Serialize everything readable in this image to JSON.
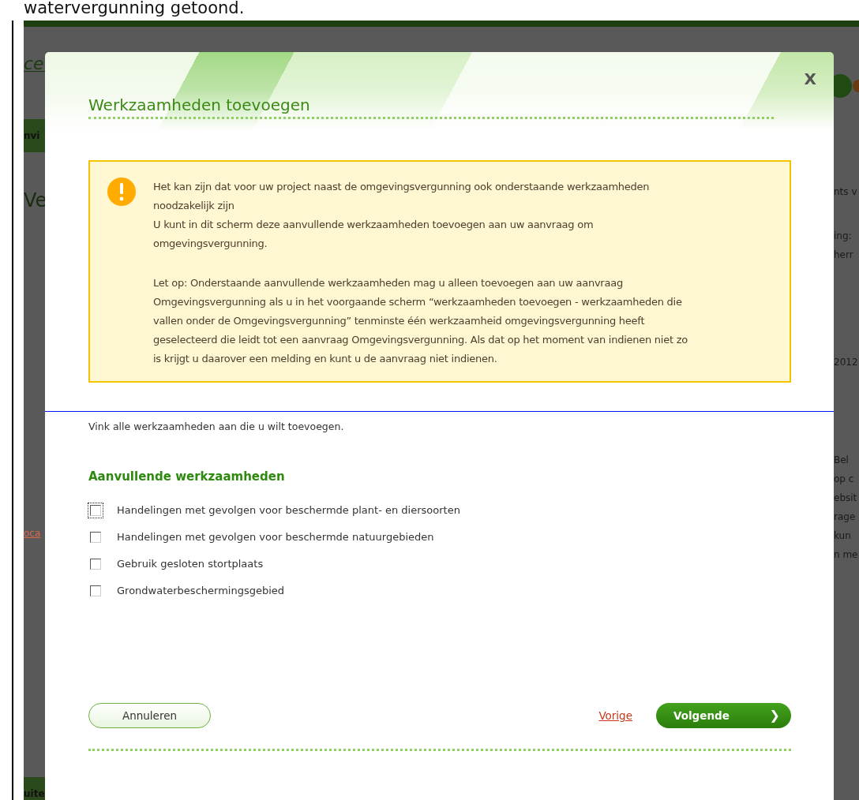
{
  "page_heading": "watervergunning getoond.",
  "background_left": [
    {
      "text": "ce",
      "kind": "logo"
    },
    {
      "text": "nvi",
      "kind": "band"
    },
    {
      "text": "Ve",
      "kind": "heading"
    },
    {
      "text": "oca",
      "kind": "link"
    },
    {
      "text": "uite",
      "kind": "band"
    }
  ],
  "background_right": [
    {
      "text": "nts v",
      "kind": "text"
    },
    {
      "text": "ing:",
      "kind": "text"
    },
    {
      "text": "herr",
      "kind": "text"
    },
    {
      "text": "2012",
      "kind": "text"
    },
    {
      "text": "Bel",
      "kind": "text"
    },
    {
      "text": "op c",
      "kind": "text"
    },
    {
      "text": "ebsit",
      "kind": "text"
    },
    {
      "text": "rage",
      "kind": "text"
    },
    {
      "text": "kun",
      "kind": "text"
    },
    {
      "text": "n me",
      "kind": "text"
    }
  ],
  "dialog": {
    "title": "Werkzaamheden toevoegen",
    "close": "X",
    "warning": [
      "Het kan zijn dat voor uw project naast de omgevingsvergunning ook onderstaande werkzaamheden noodzakelijk zijn",
      "U kunt in dit scherm deze aanvullende werkzaamheden toevoegen aan uw aanvraag om omgevingsvergunning.",
      "Let op: Onderstaande aanvullende werkzaamheden mag u alleen toevoegen aan uw aanvraag Omgevingsvergunning als u in het voorgaande scherm “werkzaamheden toevoegen - werkzaamheden die vallen onder de Omgevingsvergunning” tenminste één werkzaamheid omgevingsvergunning heeft geselecteerd die leidt tot een aanvraag Omgevingsvergunning. Als dat op het moment van indienen niet zo is krijgt u daarover een melding en kunt u de aanvraag niet indienen."
    ],
    "instruction": "Vink alle werkzaamheden aan die u wilt toevoegen.",
    "section_title": "Aanvullende werkzaamheden",
    "options": [
      {
        "label": "Handelingen met gevolgen voor beschermde plant- en diersoorten",
        "checked": false,
        "focused": true
      },
      {
        "label": "Handelingen met gevolgen voor beschermde natuurgebieden",
        "checked": false,
        "focused": false
      },
      {
        "label": "Gebruik gesloten stortplaats",
        "checked": false,
        "focused": false
      },
      {
        "label": "Grondwaterbeschermingsgebied",
        "checked": false,
        "focused": false
      }
    ],
    "buttons": {
      "cancel": "Annuleren",
      "previous": "Vorige",
      "next": "Volgende",
      "next_icon": "❯"
    }
  }
}
